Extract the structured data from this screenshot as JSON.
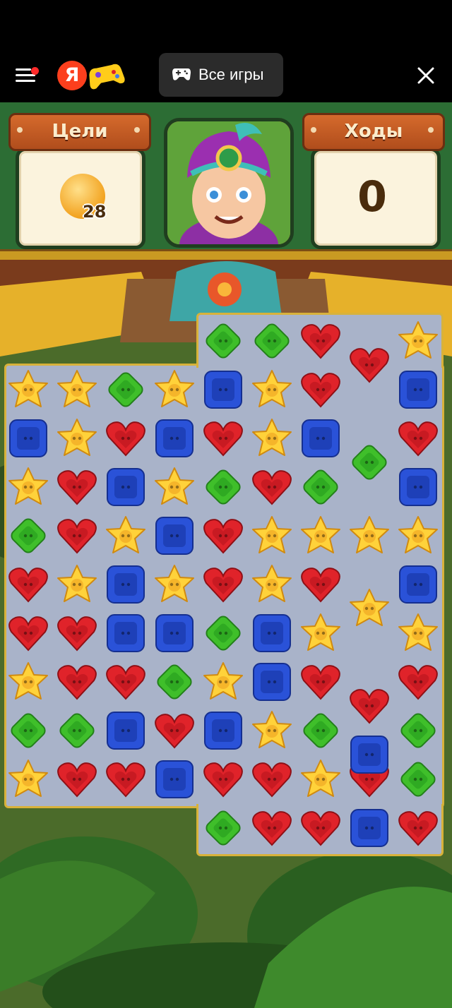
{
  "topbar": {
    "all_games_label": "Все игры",
    "ya_letter": "Я",
    "icons": [
      "menu-icon",
      "yandex-logo",
      "gamepad-icon",
      "close-icon"
    ]
  },
  "hud": {
    "goals_label": "Цели",
    "moves_label": "Ходы",
    "goal_item": "coin",
    "goal_count": "28",
    "moves_value": "0"
  },
  "colors": {
    "red": "#e0232a",
    "yellow": "#ffd23a",
    "blue": "#2a52d8",
    "green": "#3fbf2a",
    "board_border": "#d8b23a",
    "hud_green": "#2c6d34"
  },
  "board": {
    "legend": {
      "R": "red-heart",
      "Y": "yellow-star",
      "B": "blue-square",
      "G": "green-diamond",
      ".": "empty",
      "-": "no-cell"
    },
    "rows": [
      "----GGR.Y",
      "YYGYBYR.B",
      "BYRBRYB.R",
      "YRBYGRG.B",
      "GRYBRYYYY",
      "RYBYRYR.B",
      "RRBBGBY.Y",
      "YRRGYBR.R",
      "GGBRBYG.G",
      "YRRBRRYRG",
      "----GRRBR"
    ],
    "offsets": [
      {
        "row": 0,
        "col": 7,
        "piece": "R"
      },
      {
        "row": 2,
        "col": 7,
        "piece": "G"
      },
      {
        "row": 5,
        "col": 7,
        "piece": "Y"
      },
      {
        "row": 7,
        "col": 7,
        "piece": "R"
      },
      {
        "row": 8,
        "col": 7,
        "piece": "B"
      }
    ]
  }
}
